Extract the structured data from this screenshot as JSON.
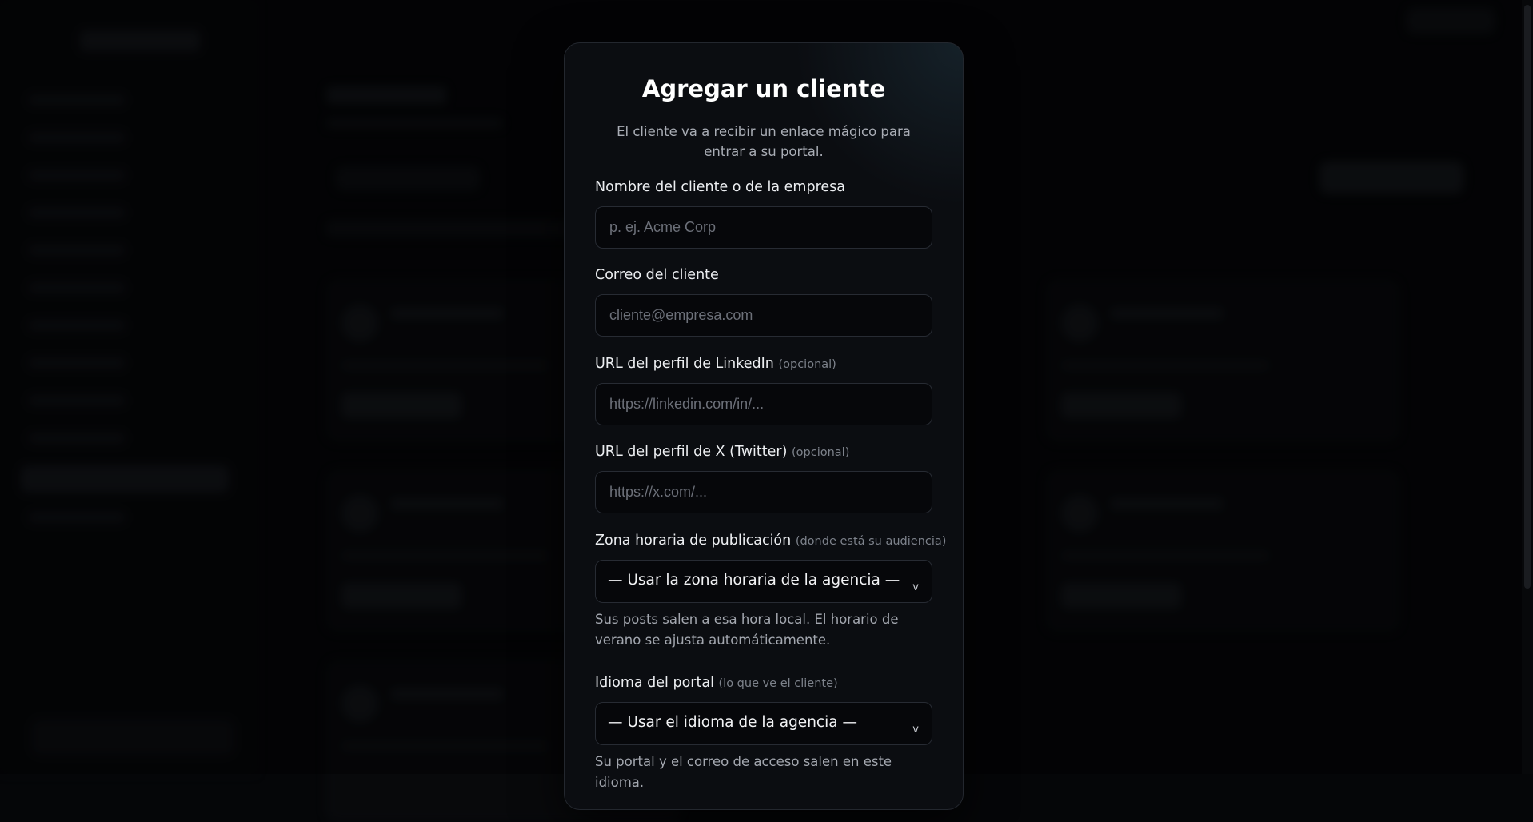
{
  "modal": {
    "title": "Agregar un cliente",
    "description": "El cliente va a recibir un enlace mágico para entrar a su portal.",
    "fields": {
      "name": {
        "label": "Nombre del cliente o de la empresa",
        "placeholder": "p. ej. Acme Corp",
        "value": ""
      },
      "email": {
        "label": "Correo del cliente",
        "placeholder": "cliente@empresa.com",
        "value": ""
      },
      "linkedin": {
        "label": "URL del perfil de LinkedIn",
        "hint": "(opcional)",
        "placeholder": "https://linkedin.com/in/...",
        "value": ""
      },
      "twitter": {
        "label": "URL del perfil de X (Twitter)",
        "hint": "(opcional)",
        "placeholder": "https://x.com/...",
        "value": ""
      },
      "timezone": {
        "label": "Zona horaria de publicación",
        "hint": "(donde está su audiencia)",
        "selected": "— Usar la zona horaria de la agencia —",
        "help": "Sus posts salen a esa hora local. El horario de verano se ajusta automáticamente."
      },
      "language": {
        "label": "Idioma del portal",
        "hint": "(lo que ve el cliente)",
        "selected": "— Usar el idioma de la agencia —",
        "help": "Su portal y el correo de acceso salen en este idioma."
      }
    },
    "chevron_glyph": "v"
  },
  "colors": {
    "backdrop": "#050608",
    "modal_bg": "#0b0d11",
    "input_border": "#272b33",
    "label": "#eceef1",
    "muted": "#a3a7af"
  }
}
